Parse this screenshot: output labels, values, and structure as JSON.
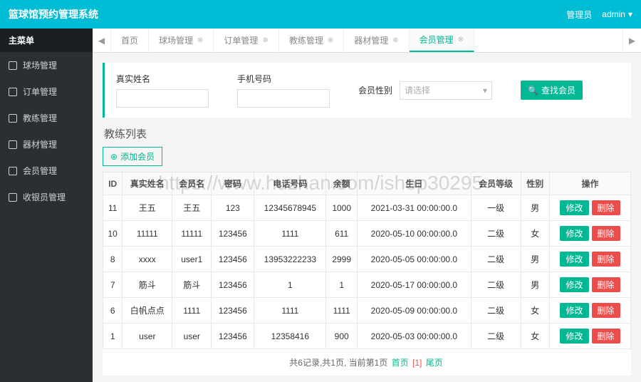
{
  "app": {
    "title": "篮球馆预约管理系统"
  },
  "top_right": {
    "role": "管理员",
    "user": "admin"
  },
  "sidebar": {
    "header": "主菜单",
    "items": [
      {
        "label": "球场管理"
      },
      {
        "label": "订单管理"
      },
      {
        "label": "教练管理"
      },
      {
        "label": "器材管理"
      },
      {
        "label": "会员管理"
      },
      {
        "label": "收银员管理"
      }
    ]
  },
  "tabs": {
    "items": [
      {
        "label": "首页"
      },
      {
        "label": "球场管理"
      },
      {
        "label": "订单管理"
      },
      {
        "label": "教练管理"
      },
      {
        "label": "器材管理"
      },
      {
        "label": "会员管理"
      }
    ],
    "active_index": 5
  },
  "search": {
    "name_label": "真实姓名",
    "name_value": "",
    "phone_label": "手机号码",
    "phone_value": "",
    "gender_label": "会员性别",
    "gender_placeholder": "请选择",
    "submit_label": "查找会员"
  },
  "section": {
    "title": "教练列表",
    "add_label": "添加会员"
  },
  "table": {
    "headers": [
      "ID",
      "真实姓名",
      "会员名",
      "密码",
      "电话号码",
      "余额",
      "生日",
      "会员等级",
      "性别",
      "操作"
    ],
    "rows": [
      {
        "cells": [
          "11",
          "王五",
          "王五",
          "123",
          "12345678945",
          "1000",
          "2021-03-31 00:00:00.0",
          "一级",
          "男"
        ]
      },
      {
        "cells": [
          "10",
          "11111",
          "11111",
          "123456",
          "1111",
          "611",
          "2020-05-10 00:00:00.0",
          "二级",
          "女"
        ]
      },
      {
        "cells": [
          "8",
          "xxxx",
          "user1",
          "123456",
          "13953222233",
          "2999",
          "2020-05-05 00:00:00.0",
          "二级",
          "男"
        ]
      },
      {
        "cells": [
          "7",
          "筋斗",
          "筋斗",
          "123456",
          "1",
          "1",
          "2020-05-17 00:00:00.0",
          "二级",
          "男"
        ]
      },
      {
        "cells": [
          "6",
          "白帆点点",
          "1111",
          "123456",
          "1111",
          "1111",
          "2020-05-09 00:00:00.0",
          "二级",
          "女"
        ]
      },
      {
        "cells": [
          "1",
          "user",
          "user",
          "123456",
          "12358416",
          "900",
          "2020-05-03 00:00:00.0",
          "二级",
          "女"
        ]
      }
    ],
    "ops": {
      "edit": "修改",
      "del": "删除"
    }
  },
  "pager": {
    "text_prefix": "共6记录,共1页, 当前第1页 ",
    "first": "首页",
    "cur": "[1]",
    "last": "尾页"
  },
  "watermark": "https://www.huzhan.com/ishop30295"
}
